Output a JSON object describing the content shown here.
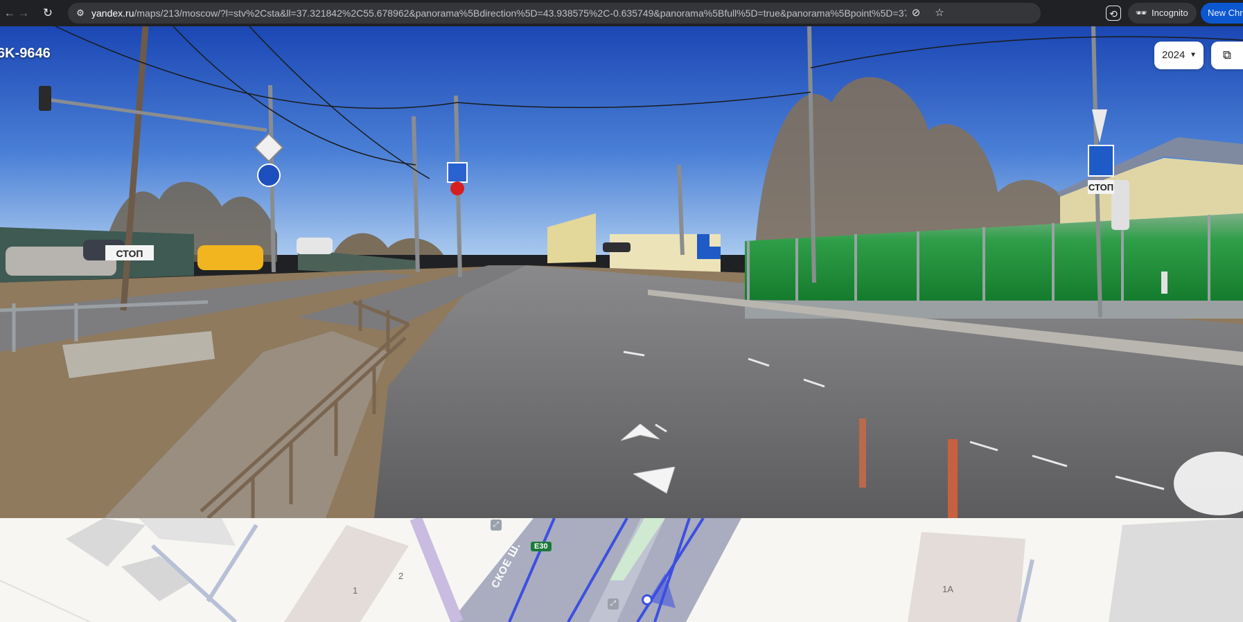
{
  "browser": {
    "back_icon": "back-arrow-icon",
    "forward_icon": "forward-arrow-icon",
    "reload_icon": "reload-icon",
    "url_host": "yandex.ru",
    "url_rest": "/maps/213/moscow/?l=stv%2Csta&ll=37.321842%2C55.678962&panorama%5Bdirection%5D=43.938575%2C-0.635749&panorama%5Bfull%5D=true&panorama%5Bpoint%5D=37.322761%2C55.679728&panor...",
    "incognito_label": "Incognito",
    "new_chrome_label": "New Chro"
  },
  "panorama": {
    "title": "6K-9646",
    "year": "2024",
    "year_caret": "▼",
    "open_icon": "external-link-icon",
    "sign_text_left": "СТОП",
    "sign_text_right": "СТОП"
  },
  "minimap": {
    "highway_badge": "E30",
    "road_name": "СКОЕ Ш.",
    "building_1": "1",
    "building_2": "2",
    "building_1a": "1А"
  },
  "colors": {
    "sky_top": "#1f4fbf",
    "sky_horizon": "#9cc0ea",
    "asphalt": "#6b6b6d",
    "fence_green": "#1f9a3a",
    "map_bg": "#f7f6f3",
    "accent_blue": "#3d4fe0"
  }
}
